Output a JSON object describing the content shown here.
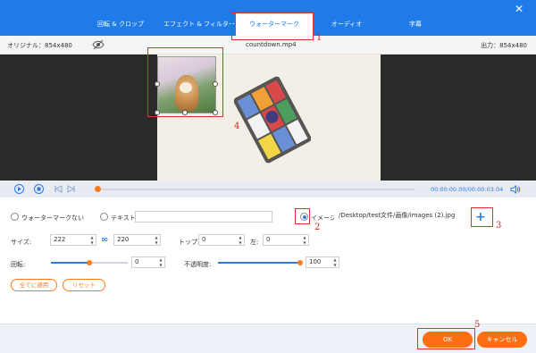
{
  "tabs": [
    {
      "label": "回転 & クロップ"
    },
    {
      "label": "エフェクト & フィルター"
    },
    {
      "label": "ウォーターマーク"
    },
    {
      "label": "オーディオ"
    },
    {
      "label": "字幕"
    }
  ],
  "info": {
    "original": "オリジナル：854x480",
    "filename": "countdown.mp4",
    "output": "出力：854x480"
  },
  "player": {
    "time": "00:00:00.00/00:00:03.04",
    "progress": 0.0
  },
  "watermark": {
    "no_watermark": "ウォーターマークない",
    "text": "テキスト",
    "text_value": "",
    "image": "イメージ",
    "image_path": "/Desktop/test文件/画像/images (2).jpg",
    "selected": "image"
  },
  "size": {
    "label": "サイズ:",
    "width": "222",
    "height": "220"
  },
  "position": {
    "top_label": "トップ:",
    "top": "0",
    "left_label": "左:",
    "left": "0"
  },
  "rotation": {
    "label": "回転:",
    "value": "0",
    "slider": 0.5
  },
  "opacity": {
    "label": "不透明度:",
    "value": "100",
    "slider": 1.0
  },
  "buttons": {
    "apply_all": "全てに適用",
    "reset": "リセット",
    "ok": "OK",
    "cancel": "キャンセル"
  },
  "annotations": [
    "1",
    "2",
    "3",
    "4",
    "5"
  ],
  "colors": {
    "accent": "#1e7be8",
    "orange": "#ff6e12",
    "annotation": "#e0302a"
  }
}
